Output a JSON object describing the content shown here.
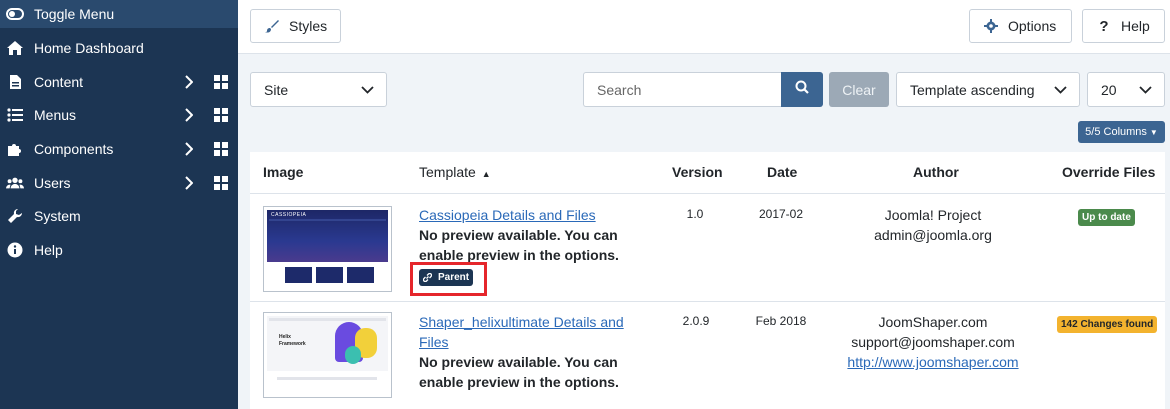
{
  "sidebar": {
    "toggle_label": "Toggle Menu",
    "items": [
      {
        "label": "Home Dashboard",
        "icon": "home-icon"
      },
      {
        "label": "Content",
        "icon": "file-icon"
      },
      {
        "label": "Menus",
        "icon": "list-icon"
      },
      {
        "label": "Components",
        "icon": "puzzle-icon"
      },
      {
        "label": "Users",
        "icon": "users-icon"
      },
      {
        "label": "System",
        "icon": "wrench-icon"
      },
      {
        "label": "Help",
        "icon": "info-icon"
      }
    ]
  },
  "toolbar": {
    "styles_label": "Styles",
    "options_label": "Options",
    "help_label": "Help"
  },
  "filters": {
    "client_value": "Site",
    "search_placeholder": "Search",
    "clear_label": "Clear",
    "ordering_value": "Template ascending",
    "limit_value": "20",
    "columns_label": "5/5 Columns"
  },
  "table": {
    "headers": {
      "image": "Image",
      "template": "Template",
      "version": "Version",
      "date": "Date",
      "author": "Author",
      "overrides": "Override Files"
    },
    "rows": [
      {
        "link": "Cassiopeia Details and Files",
        "note_line1": "No preview available. You can",
        "note_line2": "enable preview in the options.",
        "parent_badge": "Parent",
        "version": "1.0",
        "date": "2017-02",
        "author_name": "Joomla! Project",
        "author_email": "admin@joomla.org",
        "override_status": "Up to date",
        "thumb_title": "CASSIOPEIA"
      },
      {
        "link_line1": "Shaper_helixultimate Details and",
        "link_line2": "Files",
        "note_line1": "No preview available. You can",
        "note_line2": "enable preview in the options.",
        "version": "2.0.9",
        "date": "Feb 2018",
        "author_name": "JoomShaper.com",
        "author_email": "support@joomshaper.com",
        "author_url": "http://www.joomshaper.com",
        "override_status": "142 Changes found",
        "thumb_title": "Helix Framework"
      }
    ]
  },
  "colors": {
    "sidebar_bg": "#1c3553",
    "primary": "#3c6592",
    "success": "#4b8a4c",
    "warning": "#f3b32e",
    "link": "#2a69b8",
    "highlight": "#e5262b"
  }
}
